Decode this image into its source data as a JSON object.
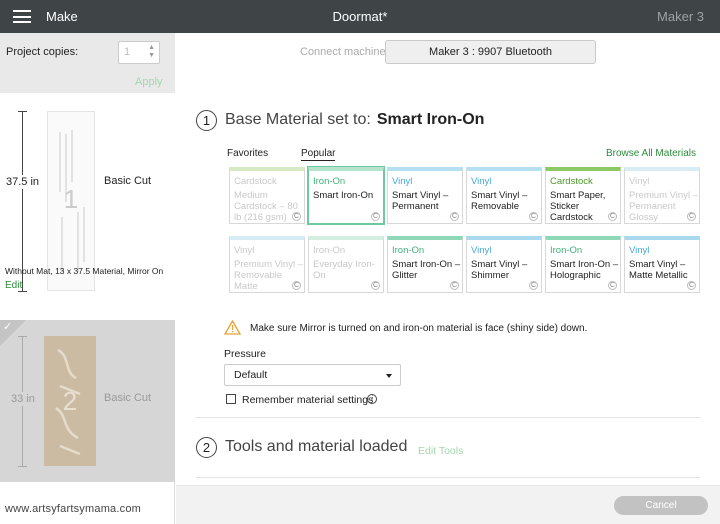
{
  "topbar": {
    "menu_label": "Make",
    "title": "Doormat*",
    "machine": "Maker 3"
  },
  "sidebar": {
    "copies_label": "Project copies:",
    "copies_value": "1",
    "apply_label": "Apply",
    "mat1": {
      "dimension": "37.5 in",
      "number": "1",
      "cut_label": "Basic Cut",
      "info": "Without Mat, 13 x 37.5 Material, Mirror On",
      "edit_label": "Edit"
    },
    "mat2": {
      "dimension": "33 in",
      "number": "2",
      "cut_label": "Basic Cut"
    },
    "watermark": "www.artsyfartsymama.com"
  },
  "connect": {
    "label": "Connect machine",
    "machine_button": "Maker 3 : 9907 Bluetooth"
  },
  "section1": {
    "number": "1",
    "title": "Base Material set to:",
    "material": "Smart Iron-On"
  },
  "tabs": {
    "favorites": "Favorites",
    "popular": "Popular",
    "browse": "Browse All Materials"
  },
  "materials_row1": [
    {
      "category": "Cardstock",
      "name": "Medium Cardstock – 80 lb (216 gsm)",
      "color": "#d7e8c5",
      "cat_color": "#c9c9c9",
      "dim": true
    },
    {
      "category": "Iron-On",
      "name": "Smart Iron-On",
      "color": "#b5e3cc",
      "cat_color": "#3fb07a",
      "selected": true
    },
    {
      "category": "Vinyl",
      "name": "Smart Vinyl – Permanent",
      "color": "#b7dff2",
      "cat_color": "#46a9d6"
    },
    {
      "category": "Vinyl",
      "name": "Smart Vinyl – Removable",
      "color": "#b7dff2",
      "cat_color": "#46a9d6"
    },
    {
      "category": "Cardstock",
      "name": "Smart Paper, Sticker Cardstock",
      "color": "#8cc864",
      "cat_color": "#4c9a2a"
    },
    {
      "category": "Vinyl",
      "name": "Premium Vinyl – Permanent Glossy",
      "color": "#d8ecf5",
      "cat_color": "#c9c9c9",
      "dim": true
    }
  ],
  "materials_row2": [
    {
      "category": "Vinyl",
      "name": "Premium Vinyl – Removable Matte",
      "color": "#d8ecf5",
      "cat_color": "#c9c9c9",
      "dim": true
    },
    {
      "category": "Iron-On",
      "name": "Everyday Iron-On",
      "color": "#d4efe2",
      "cat_color": "#c9c9c9",
      "dim": true
    },
    {
      "category": "Iron-On",
      "name": "Smart Iron-On – Glitter",
      "color": "#8fd8b7",
      "cat_color": "#3fb07a"
    },
    {
      "category": "Vinyl",
      "name": "Smart Vinyl – Shimmer",
      "color": "#a9d9ef",
      "cat_color": "#46a9d6"
    },
    {
      "category": "Iron-On",
      "name": "Smart Iron-On – Holographic",
      "color": "#8fd8b7",
      "cat_color": "#3fb07a"
    },
    {
      "category": "Vinyl",
      "name": "Smart Vinyl – Matte Metallic",
      "color": "#a9d9ef",
      "cat_color": "#46a9d6"
    }
  ],
  "card_badge": "C",
  "warning": "Make sure Mirror is turned on and iron-on material is face (shiny side) down.",
  "pressure": {
    "label": "Pressure",
    "value": "Default"
  },
  "remember_label": "Remember material settings",
  "section2": {
    "number": "2",
    "title": "Tools and material loaded",
    "edit_tools": "Edit Tools"
  },
  "footer": {
    "cancel": "Cancel"
  }
}
